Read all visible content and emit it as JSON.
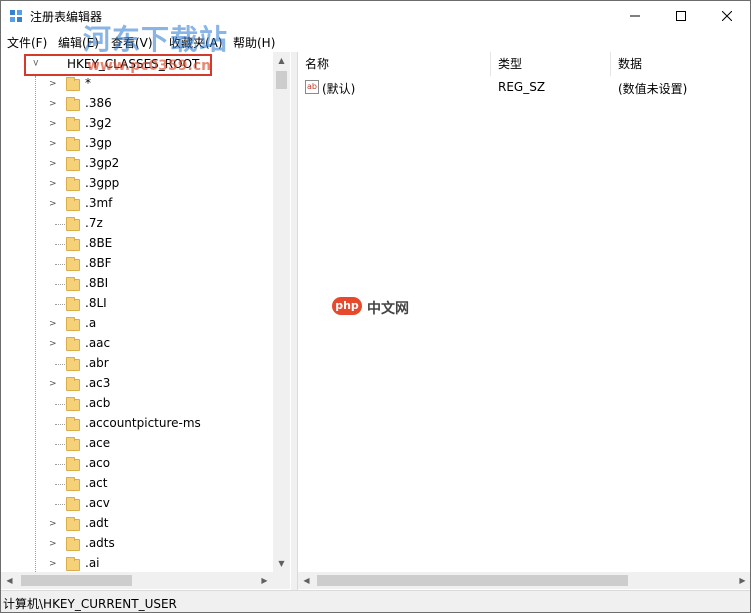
{
  "window": {
    "title": "注册表编辑器",
    "controls": {
      "minimize": "—",
      "maximize": "☐",
      "close": "✕"
    }
  },
  "menu": [
    {
      "label": "文件(F)"
    },
    {
      "label": "编辑(E)"
    },
    {
      "label": "查看(V)"
    },
    {
      "label": "收藏夹(A)"
    },
    {
      "label": "帮助(H)"
    }
  ],
  "tree": {
    "root": "HKEY_CLASSES_ROOT",
    "items": [
      {
        "label": "*",
        "expandable": true
      },
      {
        "label": ".386",
        "expandable": true
      },
      {
        "label": ".3g2",
        "expandable": true
      },
      {
        "label": ".3gp",
        "expandable": true
      },
      {
        "label": ".3gp2",
        "expandable": true
      },
      {
        "label": ".3gpp",
        "expandable": true
      },
      {
        "label": ".3mf",
        "expandable": true
      },
      {
        "label": ".7z",
        "expandable": false
      },
      {
        "label": ".8BE",
        "expandable": false
      },
      {
        "label": ".8BF",
        "expandable": false
      },
      {
        "label": ".8BI",
        "expandable": false
      },
      {
        "label": ".8LI",
        "expandable": false
      },
      {
        "label": ".a",
        "expandable": true
      },
      {
        "label": ".aac",
        "expandable": true
      },
      {
        "label": ".abr",
        "expandable": false
      },
      {
        "label": ".ac3",
        "expandable": true
      },
      {
        "label": ".acb",
        "expandable": false
      },
      {
        "label": ".accountpicture-ms",
        "expandable": false
      },
      {
        "label": ".ace",
        "expandable": false
      },
      {
        "label": ".aco",
        "expandable": false
      },
      {
        "label": ".act",
        "expandable": false
      },
      {
        "label": ".acv",
        "expandable": false
      },
      {
        "label": ".adt",
        "expandable": true
      },
      {
        "label": ".adts",
        "expandable": true
      },
      {
        "label": ".ai",
        "expandable": true
      }
    ]
  },
  "list": {
    "columns": {
      "name": "名称",
      "type": "类型",
      "data": "数据"
    },
    "rows": [
      {
        "icon": "string-value-icon",
        "icon_text": "ab",
        "name": "(默认)",
        "type": "REG_SZ",
        "data": "(数值未设置)"
      }
    ]
  },
  "status": {
    "path": "计算机\\HKEY_CURRENT_USER"
  },
  "watermarks": {
    "site_title": "河东下载站",
    "site_url": "www.pc0359.cn",
    "php_badge": "php",
    "php_text": "中文网"
  },
  "colors": {
    "highlight_border": "#d23a2c",
    "folder": "#f5d27a"
  }
}
